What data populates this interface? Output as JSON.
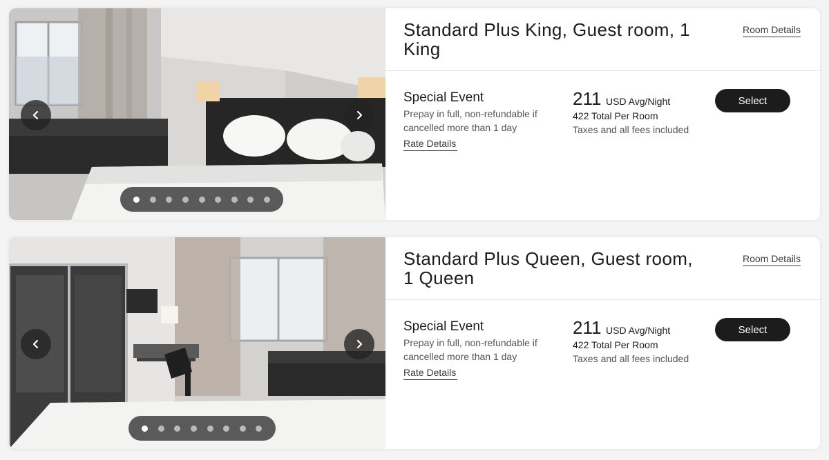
{
  "rooms": [
    {
      "title": "Standard Plus King, Guest room, 1 King",
      "room_details_label": "Room Details",
      "rate_name": "Special Event",
      "rate_description": "Prepay in full, non-refundable if cancelled more than 1 day after…",
      "rate_details_label": "Rate Details",
      "price": "211",
      "price_unit": "USD Avg/Night",
      "total": "422 Total Per Room",
      "taxes": "Taxes and all fees included",
      "select_label": "Select",
      "photo_count": 9,
      "active_photo": 1
    },
    {
      "title": "Standard Plus Queen, Guest room, 1 Queen",
      "room_details_label": "Room Details",
      "rate_name": "Special Event",
      "rate_description": "Prepay in full, non-refundable if cancelled more than 1 day after…",
      "rate_details_label": "Rate Details",
      "price": "211",
      "price_unit": "USD Avg/Night",
      "total": "422 Total Per Room",
      "taxes": "Taxes and all fees included",
      "select_label": "Select",
      "photo_count": 8,
      "active_photo": 1
    }
  ],
  "icons": {
    "prev": "chevron-left-icon",
    "next": "chevron-right-icon"
  },
  "colors": {
    "button_bg": "#1c1c1c",
    "button_text": "#ffffff",
    "page_bg": "#f4f4f4",
    "card_bg": "#ffffff"
  }
}
